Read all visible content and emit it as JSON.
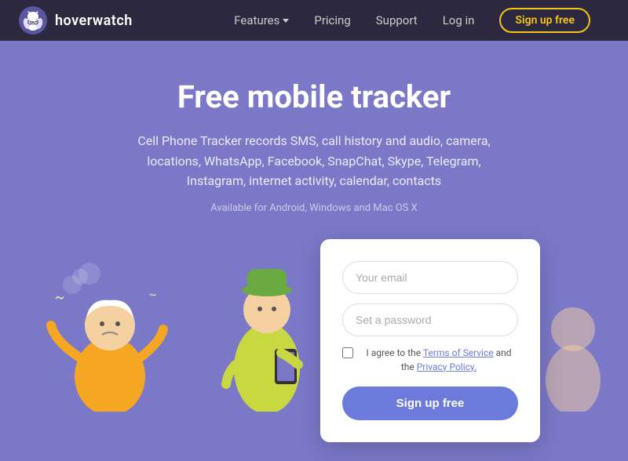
{
  "navbar": {
    "logo_text": "hoverwatch",
    "nav": {
      "features_label": "Features",
      "pricing_label": "Pricing",
      "support_label": "Support",
      "login_label": "Log in",
      "signup_label": "Sign up free"
    }
  },
  "hero": {
    "title": "Free mobile tracker",
    "subtitle": "Cell Phone Tracker records SMS, call history and audio, camera, locations, WhatsApp, Facebook, SnapChat, Skype, Telegram, Instagram, internet activity, calendar, contacts",
    "platforms": "Available for Android, Windows and Mac OS X"
  },
  "signup_card": {
    "email_placeholder": "Your email",
    "password_placeholder": "Set a password",
    "terms_text_before": "I agree to the ",
    "terms_link": "Terms of Service",
    "terms_text_middle": " and the ",
    "privacy_link": "Privacy Policy.",
    "signup_button": "Sign up free"
  },
  "icons": {
    "logo": "owl-icon",
    "features_chevron": "chevron-down-icon"
  }
}
